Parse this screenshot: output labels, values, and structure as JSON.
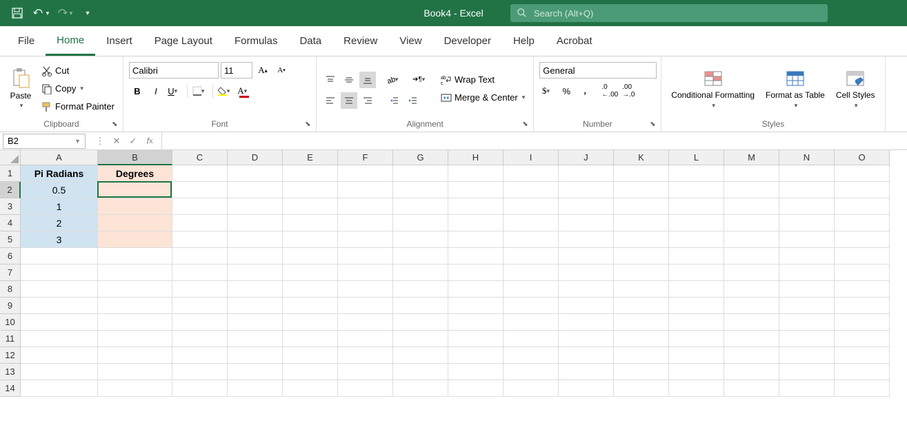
{
  "title": "Book4  -  Excel",
  "search": {
    "placeholder": "Search (Alt+Q)"
  },
  "tabs": [
    "File",
    "Home",
    "Insert",
    "Page Layout",
    "Formulas",
    "Data",
    "Review",
    "View",
    "Developer",
    "Help",
    "Acrobat"
  ],
  "activeTab": "Home",
  "clipboard": {
    "paste": "Paste",
    "cut": "Cut",
    "copy": "Copy",
    "formatPainter": "Format Painter",
    "label": "Clipboard"
  },
  "font": {
    "name": "Calibri",
    "size": "11",
    "label": "Font"
  },
  "alignment": {
    "wrap": "Wrap Text",
    "merge": "Merge & Center",
    "label": "Alignment"
  },
  "number": {
    "format": "General",
    "label": "Number"
  },
  "styles": {
    "conditional": "Conditional Formatting",
    "formatTable": "Format as Table",
    "cellStyles": "Cell Styles",
    "label": "Styles"
  },
  "nameBox": "B2",
  "formulaValue": "",
  "columns": [
    "A",
    "B",
    "C",
    "D",
    "E",
    "F",
    "G",
    "H",
    "I",
    "J",
    "K",
    "L",
    "M",
    "N",
    "O"
  ],
  "rows": [
    "1",
    "2",
    "3",
    "4",
    "5",
    "6",
    "7",
    "8",
    "9",
    "10",
    "11",
    "12",
    "13",
    "14"
  ],
  "cellData": {
    "A1": "Pi Radians",
    "B1": "Degrees",
    "A2": "0.5",
    "A3": "1",
    "A4": "2",
    "A5": "3"
  },
  "activeCell": {
    "row": 2,
    "col": "B"
  }
}
